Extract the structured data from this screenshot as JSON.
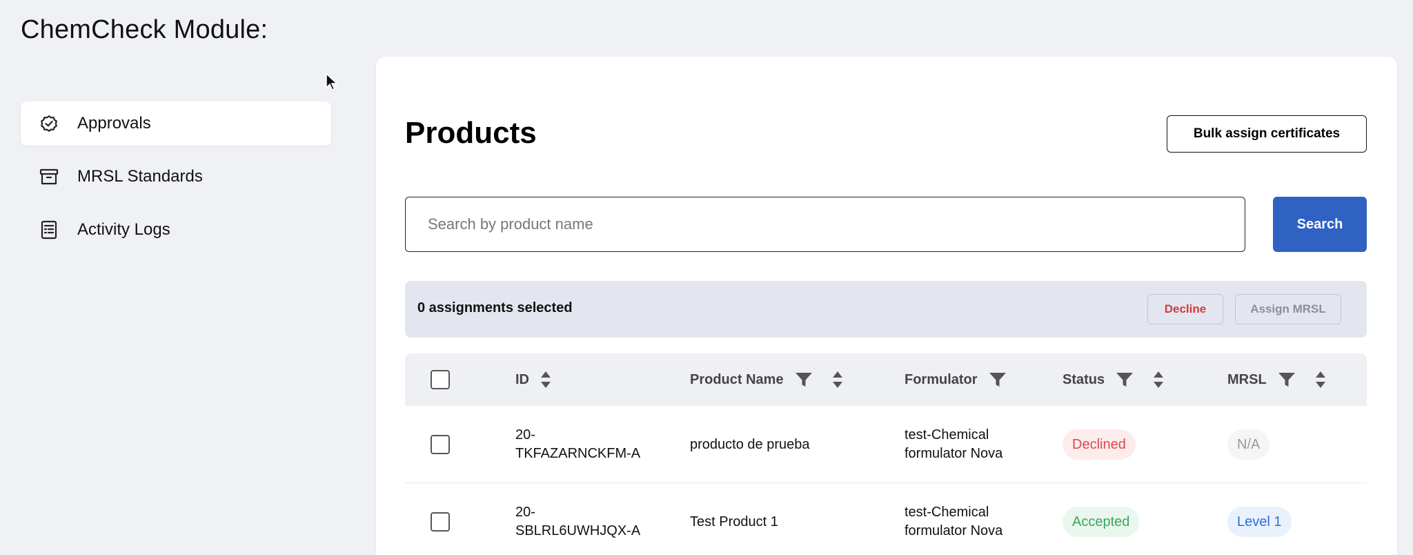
{
  "app": {
    "title": "ChemCheck Module:"
  },
  "sidebar": {
    "items": [
      {
        "label": "Approvals",
        "icon": "badge-check-icon",
        "active": true
      },
      {
        "label": "MRSL Standards",
        "icon": "archive-box-icon",
        "active": false
      },
      {
        "label": "Activity Logs",
        "icon": "document-list-icon",
        "active": false
      }
    ]
  },
  "main": {
    "title": "Products",
    "bulk_button": "Bulk assign certificates",
    "search": {
      "placeholder": "Search by product name",
      "value": "",
      "button": "Search"
    },
    "selection": {
      "text": "0 assignments selected",
      "decline": "Decline",
      "assign": "Assign MRSL"
    },
    "table": {
      "columns": [
        "ID",
        "Product Name",
        "Formulator",
        "Status",
        "MRSL"
      ],
      "rows": [
        {
          "id_line1": "20-",
          "id_line2": "TKFAZARNCKFM-A",
          "product": "producto de prueba",
          "formulator_line1": "test-Chemical",
          "formulator_line2": "formulator Nova",
          "status": "Declined",
          "mrsl": "N/A"
        },
        {
          "id_line1": "20-",
          "id_line2": "SBLRL6UWHJQX-A",
          "product": "Test Product 1",
          "formulator_line1": "test-Chemical",
          "formulator_line2": "formulator Nova",
          "status": "Accepted",
          "mrsl": "Level 1"
        }
      ]
    }
  },
  "colors": {
    "primary": "#2f62c3",
    "declined": "#d94a4a",
    "accepted": "#3aa55c",
    "level": "#2f6fd6"
  }
}
